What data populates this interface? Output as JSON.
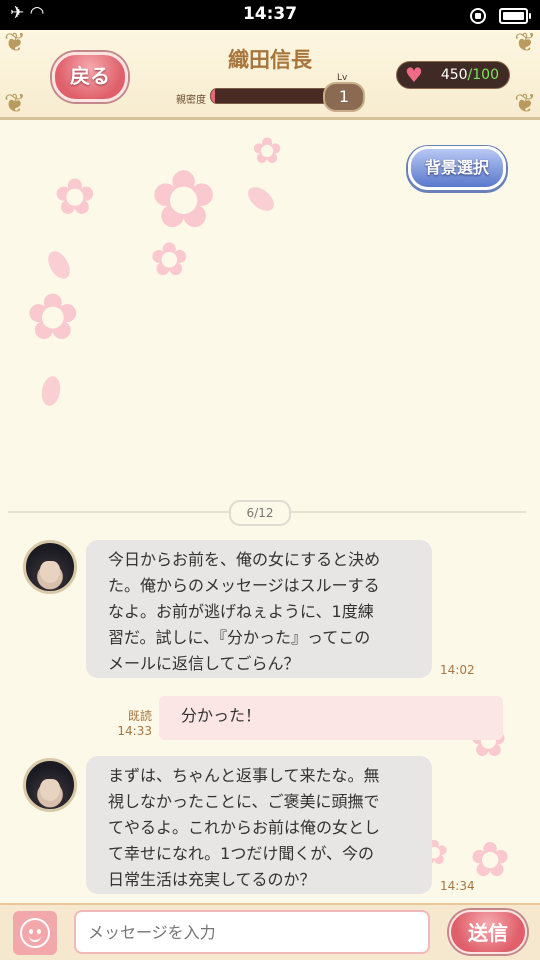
{
  "status_bar": {
    "time": "14:37"
  },
  "header": {
    "back_label": "戻る",
    "character_name": "織田信長",
    "affinity_label": "親密度",
    "affinity_progress": 0.03,
    "level_label": "Lv",
    "level": "1",
    "hearts_current": "450",
    "hearts_max": "/100",
    "accent_color": "#df5f6a"
  },
  "toolbar": {
    "background_select_label": "背景選択"
  },
  "chat": {
    "page_indicator": "6/12",
    "messages": [
      {
        "sender": "character",
        "text": "今日からお前を、俺の女にすると決め\nた。俺からのメッセージはスルーする\nなよ。お前が逃げねぇように、1度練\n習だ。試しに、『分かった』ってこの\nメールに返信してごらん？",
        "time": "14:02"
      },
      {
        "sender": "user",
        "text": "分かった！",
        "read_label": "既読",
        "time": "14:33"
      },
      {
        "sender": "character",
        "text": "まずは、ちゃんと返事して来たな。無\n視しなかったことに、ご褒美に頭撫で\nてやるよ。これからお前は俺の女とし\nて幸せになれ。1つだけ聞くが、今の\n日常生活は充実してるのか？",
        "time": "14:34"
      }
    ]
  },
  "input_bar": {
    "placeholder": "メッセージを入力",
    "send_label": "送信"
  }
}
